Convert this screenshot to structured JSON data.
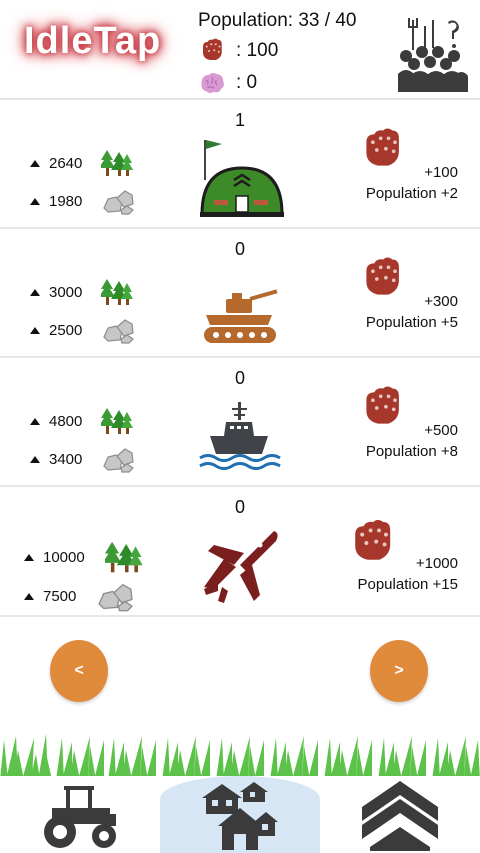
{
  "header": {
    "logo": "IdleTap",
    "population": "Population: 33 / 40",
    "strength": ": 100",
    "brains": ": 0"
  },
  "units": [
    {
      "count": "1",
      "wood": "2640",
      "stone": "1980",
      "power": "+100",
      "population": "Population +2"
    },
    {
      "count": "0",
      "wood": "3000",
      "stone": "2500",
      "power": "+300",
      "population": "Population +5"
    },
    {
      "count": "0",
      "wood": "4800",
      "stone": "3400",
      "power": "+500",
      "population": "Population +8"
    },
    {
      "count": "0",
      "wood": "10000",
      "stone": "7500",
      "power": "+1000",
      "population": "Population +15"
    }
  ],
  "nav": {
    "prev": "<",
    "next": ">"
  },
  "colors": {
    "accent": "#e08a3c",
    "fist": "#a8372b",
    "tab_active": "#d6e6f5"
  }
}
